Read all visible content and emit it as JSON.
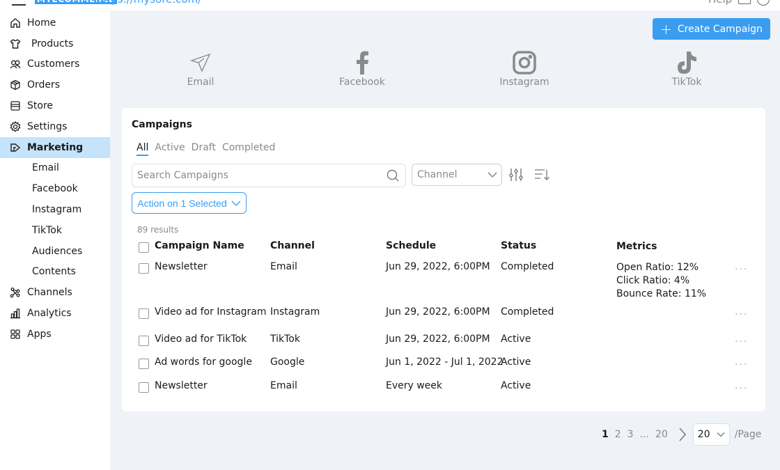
{
  "header": {
    "logo": "MYECOMMERCE",
    "url": "https://mysore.com/",
    "help": "Help"
  },
  "sidebar": {
    "items": [
      {
        "label": "Home",
        "icon": "home-icon"
      },
      {
        "label": "Products",
        "icon": "shirt-icon"
      },
      {
        "label": "Customers",
        "icon": "users-icon"
      },
      {
        "label": "Orders",
        "icon": "box-icon"
      },
      {
        "label": "Store",
        "icon": "store-icon"
      },
      {
        "label": "Settings",
        "icon": "gear-icon"
      },
      {
        "label": "Marketing",
        "icon": "megaphone-icon",
        "active": true
      },
      {
        "label": "Email",
        "sub": true
      },
      {
        "label": "Facebook",
        "sub": true
      },
      {
        "label": "Instagram",
        "sub": true
      },
      {
        "label": "TikTok",
        "sub": true
      },
      {
        "label": "Audiences",
        "sub": true
      },
      {
        "label": "Contents",
        "sub": true
      },
      {
        "label": "Channels",
        "icon": "network-icon"
      },
      {
        "label": "Analytics",
        "icon": "bar-chart-icon"
      },
      {
        "label": "Apps",
        "icon": "grid-icon"
      }
    ]
  },
  "main": {
    "create_button": "Create Campaign",
    "channels": [
      {
        "label": "Email",
        "icon": "paper-plane-icon"
      },
      {
        "label": "Facebook",
        "icon": "facebook-icon"
      },
      {
        "label": "Instagram",
        "icon": "instagram-icon"
      },
      {
        "label": "TikTok",
        "icon": "tiktok-icon"
      }
    ],
    "campaigns": {
      "title": "Campaigns",
      "tabs": [
        "All",
        "Active",
        "Draft",
        "Completed"
      ],
      "active_tab": "All",
      "search_placeholder": "Search Campaigns",
      "channel_select": "Channel",
      "action_button": "Action on 1 Selected",
      "results": "89 results",
      "columns": [
        "Campaign Name",
        "Channel",
        "Schedule",
        "Status",
        "Metrics"
      ],
      "rows": [
        {
          "name": "Newsletter",
          "channel": "Email",
          "schedule": "Jun 29, 2022, 6:00PM",
          "status": "Completed",
          "metrics": [
            "Open Ratio: 12%",
            "Click Ratio: 4%",
            "Bounce Rate: 11%"
          ]
        },
        {
          "name": "Video ad for Instagram",
          "channel": "Instagram",
          "schedule": "Jun 29, 2022, 6:00PM",
          "status": "Completed",
          "metrics": []
        },
        {
          "name": "Video ad for TikTok",
          "channel": "TikTok",
          "schedule": "Jun 29, 2022, 6:00PM",
          "status": "Active",
          "metrics": []
        },
        {
          "name": "Ad words for google",
          "channel": "Google",
          "schedule": "Jun 1, 2022 - Jul 1, 2022",
          "status": "Active",
          "metrics": []
        },
        {
          "name": "Newsletter",
          "channel": "Email",
          "schedule": "Every week",
          "status": "Active",
          "metrics": []
        }
      ],
      "more_label": "..."
    },
    "pagination": {
      "pages": [
        "1",
        "2",
        "3",
        "...",
        "20"
      ],
      "current": "1",
      "page_size": "20",
      "per_page_label": "/Page"
    }
  },
  "colors": {
    "accent": "#3b9df0",
    "active_nav": "#c5e3fb",
    "main_bg": "#eff2f7"
  }
}
